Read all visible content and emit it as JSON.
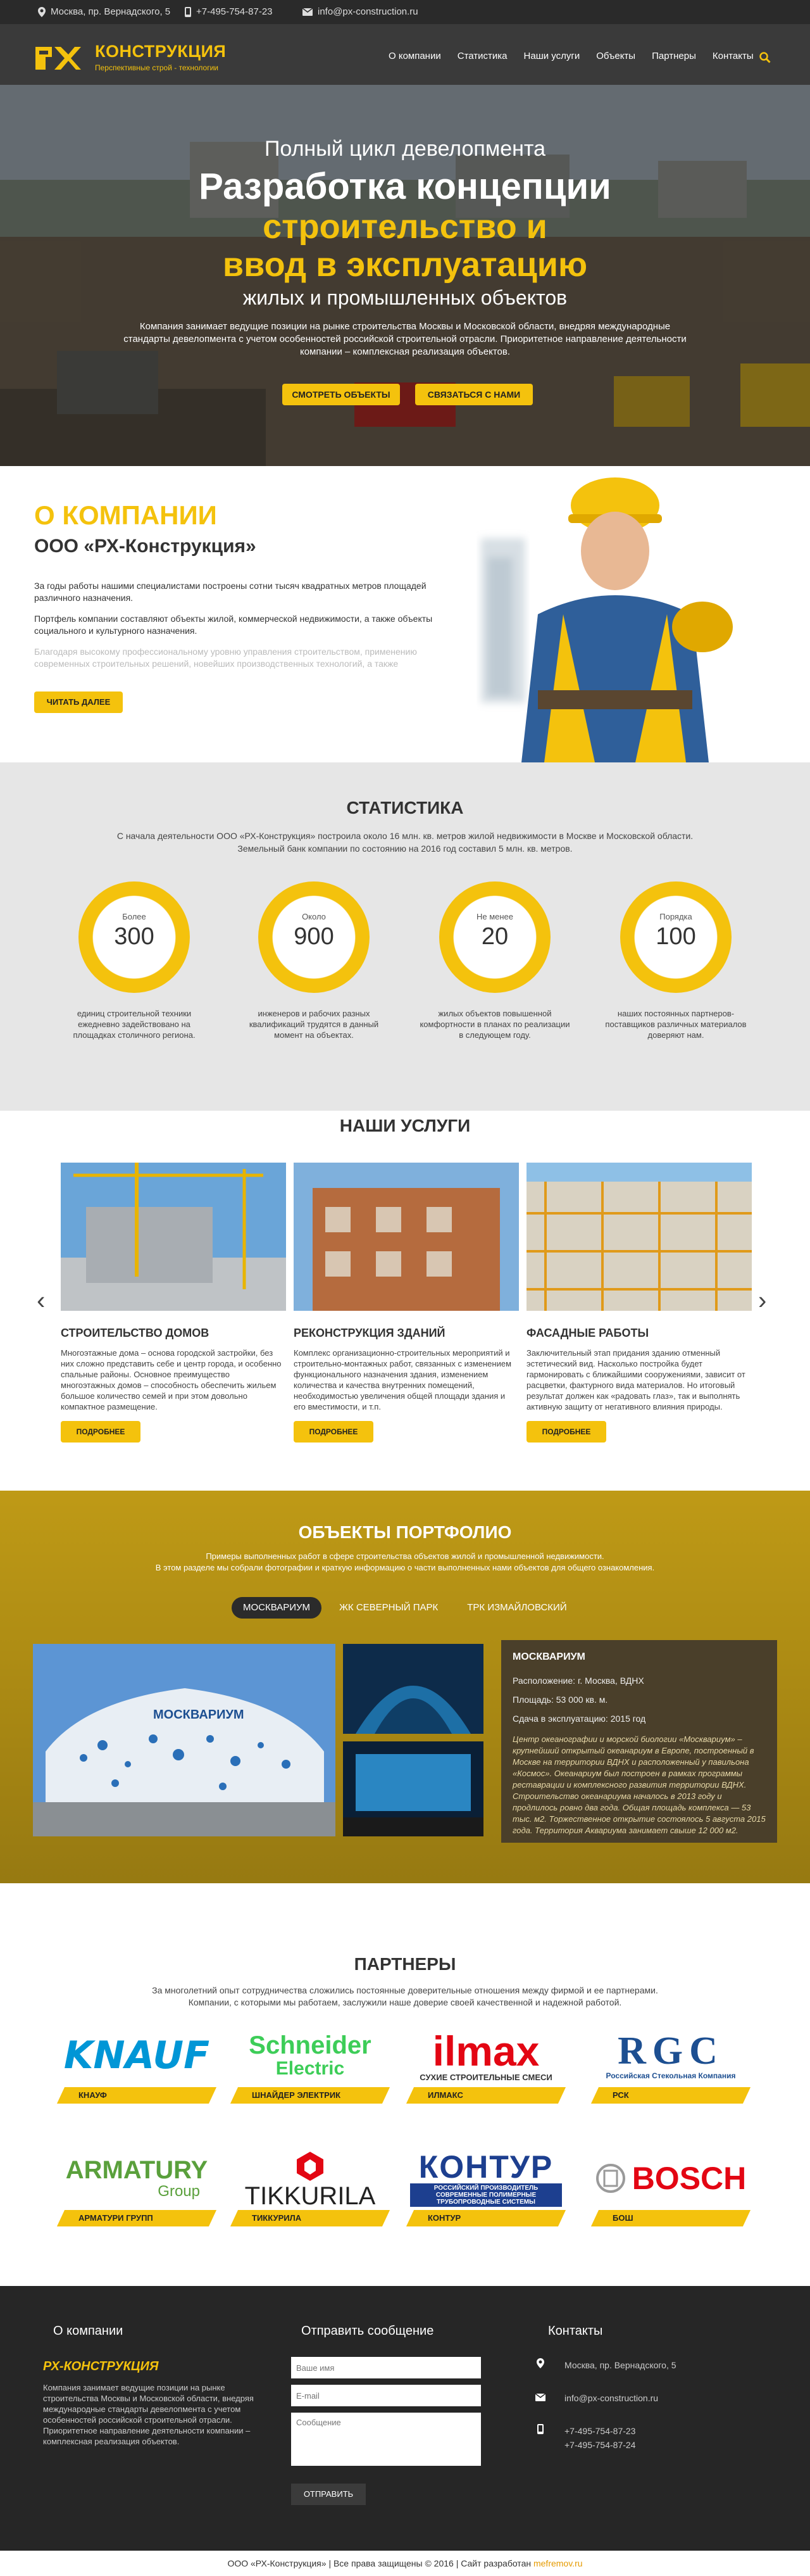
{
  "topbar": {
    "address": "Москва, пр. Вернадского, 5",
    "phone": "+7-495-754-87-23",
    "email": "info@px-construction.ru"
  },
  "header": {
    "logo_title": "Конструкция",
    "logo_sub": "Перспективные строй - технологии",
    "nav": [
      "О компании",
      "Статистика",
      "Наши услуги",
      "Объекты",
      "Партнеры",
      "Контакты"
    ]
  },
  "hero": {
    "pre": "Полный цикл девелопмента",
    "line1": "Разработка концепции",
    "line2": "строительство и",
    "line3": "ввод в эксплуатацию",
    "line4": "жилых и промышленных объектов",
    "text": "Компания занимает ведущие позиции на рынке строительства Москвы и Московской области, внедряя международные стандарты девелопмента с учетом особенностей российской строительной отрасли. Приоритетное направление деятельности компании – комплексная реализация объектов.",
    "btn1": "Смотреть объекты",
    "btn2": "Связаться с нами"
  },
  "about": {
    "title": "О КОМПАНИИ",
    "subtitle": "ООО «РХ-Конструкция»",
    "p1": "За годы работы нашими специалистами построены сотни тысяч квадратных метров площадей различного назначения.",
    "p2": "Портфель компании составляют объекты жилой, коммерческой недвижимости, а также объекты социального и культурного назначения.",
    "p3": "Благодаря высокому профессиональному уровню управления строительством, применению современных строительных решений, новейших производственных технологий, а также",
    "btn": "Читать далее"
  },
  "stats": {
    "title": "Статистика",
    "intro": "С начала деятельности ООО «РХ-Конструкция» построила около 16 млн. кв. метров жилой недвижимости в Москве и Московской области. Земельный банк компании по состоянию на 2016 год составил 5 млн. кв. метров.",
    "items": [
      {
        "small": "Более",
        "num": "300",
        "desc": "единиц строительной техники ежедневно задействовано на площадках столичного региона."
      },
      {
        "small": "Около",
        "num": "900",
        "desc": "инженеров и рабочих разных квалификаций трудятся в данный момент на объектах."
      },
      {
        "small": "Не менее",
        "num": "20",
        "desc": "жилых объектов повышенной комфортности в планах по реализации в следующем году."
      },
      {
        "small": "Порядка",
        "num": "100",
        "desc": "наших постоянных партнеров-поставщиков различных материалов доверяют нам."
      }
    ]
  },
  "services": {
    "title": "Наши услуги",
    "btn": "Подробнее",
    "items": [
      {
        "title": "Строительство домов",
        "text": "Многоэтажные дома – основа городской застройки, без них сложно представить себе и центр города, и особенно спальные районы. Основное преимущество многоэтажных домов – способность обеспечить жильем большое количество семей и при этом довольно компактное размещение."
      },
      {
        "title": "Реконструкция зданий",
        "text": "Комплекс организационно-строительных мероприятий и строительно-монтажных работ, связанных с изменением функционального назначения здания, изменением количества и качества внутренних помещений, необходимостью увеличения общей площади здания и его вместимости, и т.п."
      },
      {
        "title": "Фасадные работы",
        "text": "Заключительный этап придания зданию отменный эстетический вид. Насколько постройка будет гармонировать с ближайшими сооружениями, зависит от расцветки, фактурного вида материалов. Но итоговый результат должен как «радовать глаз», так и выполнять активную защиту от негативного влияния природы."
      }
    ]
  },
  "portfolio": {
    "title": "Объекты портфолио",
    "intro1": "Примеры выполненных работ в сфере строительства объектов жилой и промышленной недвижимости.",
    "intro2": "В этом разделе мы собрали фотографии и краткую информацию о части выполненных нами объектов для общего ознакомления.",
    "tabs": [
      "Москвариум",
      "ЖК Северный парк",
      "ТРК Измайловский"
    ],
    "sign": "МОСКВАРИУМ",
    "info": {
      "title": "МОСКВАРИУМ",
      "location": "Расположение: г. Москва, ВДНХ",
      "area": "Площадь: 53 000 кв. м.",
      "year": "Сдача в эксплуатацию: 2015 год",
      "desc": "Центр океанографии и морской биологии «Москвариум» – крупнейший открытый океанариум в Европе, построенный в Москве на территории ВДНХ и расположенный у павильона «Космос». Океанариум был построен в рамках программы реставрации и комплексного развития территории ВДНХ. Строительство океанариума началось в 2013 году и продлилось ровно два года. Общая площадь комплекса — 53 тыс. м2. Торжественное открытие состоялось 5 августа 2015 года. Территория Аквариума занимает свыше 12 000 м2."
    }
  },
  "partners": {
    "title": "Партнеры",
    "intro": "За многолетний опыт сотрудничества сложились постоянные доверительные отношения между фирмой и ее партнерами. Компании, с которыми мы работаем, заслужили наше доверие своей качественной и надежной работой.",
    "items": [
      {
        "logo": "KNAUF",
        "label": "Кнауф",
        "color": "#0096d6"
      },
      {
        "logo": "Schneider",
        "logo2": "Electric",
        "label": "Шнайдер электрик",
        "color": "#3dcd58"
      },
      {
        "logo": "ilmax",
        "logo2": "СУХИЕ СТРОИТЕЛЬНЫЕ СМЕСИ",
        "label": "Илмакс",
        "color": "#e30613"
      },
      {
        "logo": "RGC",
        "logo2": "Российская Стекольная Компания",
        "label": "РСК",
        "color": "#1d4f91"
      },
      {
        "logo": "ARMATURY",
        "logo2": "Group",
        "label": "Арматури групп",
        "color": "#5aa03c"
      },
      {
        "logo": "TIKKURILA",
        "label": "Тиккурила",
        "color": "#e30613"
      },
      {
        "logo": "КОНТУР",
        "logo2": "РОССИЙСКИЙ ПРОИЗВОДИТЕЛЬ СОВРЕМЕННЫЕ ПОЛИМЕРНЫЕ ТРУБОПРОВОДНЫЕ СИСТЕМЫ",
        "label": "Контур",
        "color": "#1d3f8f"
      },
      {
        "logo": "BOSCH",
        "label": "Бош",
        "color": "#e30613"
      }
    ]
  },
  "footer": {
    "about_title": "О компании",
    "brand": "РХ-КОНСТРУКЦИЯ",
    "about_text": "Компания занимает ведущие позиции на рынке строительства Москвы и Московской области, внедряя международные стандарты девелопмента с учетом особенностей российской строительной отрасли. Приоритетное направление деятельности компании – комплексная реализация объектов.",
    "form_title": "Отправить сообщение",
    "name_placeholder": "Ваше имя",
    "email_placeholder": "E-mail",
    "msg_placeholder": "Сообщение",
    "send": "Отправить",
    "contacts_title": "Контакты",
    "address": "Москва, пр. Вернадского, 5",
    "email": "info@px-construction.ru",
    "phone1": "+7-495-754-87-23",
    "phone2": "+7-495-754-87-24",
    "copyright": "ООО «РХ-Конструкция» | Все права защищены © 2016 | Сайт разработан",
    "dev": "mefremov.ru"
  },
  "colors": {
    "accent": "#f4c20d",
    "dark": "#2a2a2a"
  }
}
